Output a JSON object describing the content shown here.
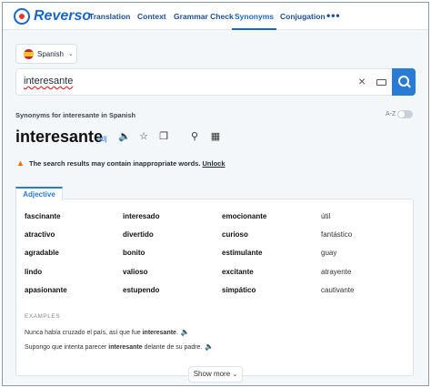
{
  "brand": {
    "name": "Reverso"
  },
  "nav": {
    "items": [
      {
        "label": "Translation"
      },
      {
        "label": "Context"
      },
      {
        "label": "Grammar Check"
      },
      {
        "label": "Synonyms"
      },
      {
        "label": "Conjugation"
      }
    ],
    "more_label": "•••"
  },
  "language": {
    "selected": "Spanish",
    "flag": "spain-flag-icon"
  },
  "search": {
    "value": "interesante",
    "clear_icon": "close-icon",
    "keyboard_icon": "keyboard-icon",
    "search_icon": "search-icon"
  },
  "results": {
    "heading": "Synonyms for interesante in Spanish",
    "sort_label": "A-Z",
    "word": "interesante",
    "part_of_speech": "adj",
    "tools": [
      "speaker-icon",
      "star-icon",
      "copy-icon",
      "zoom-icon",
      "document-icon"
    ],
    "warning_text": "The search results may contain inappropriate words.",
    "unlock_label": "Unlock"
  },
  "tab": {
    "label": "Adjective"
  },
  "synonyms": [
    [
      "fascinante",
      "interesado",
      "emocionante",
      "útil"
    ],
    [
      "atractivo",
      "divertido",
      "curioso",
      "fantástico"
    ],
    [
      "agradable",
      "bonito",
      "estimulante",
      "guay"
    ],
    [
      "lindo",
      "valioso",
      "excitante",
      "atrayente"
    ],
    [
      "apasionante",
      "estupendo",
      "simpático",
      "cautivante"
    ]
  ],
  "examples": {
    "label": "EXAMPLES",
    "items": [
      {
        "before": "Nunca había cruzado el país, así que fue ",
        "highlight": "interesante",
        "after": "."
      },
      {
        "before": "Supongo que intenta parecer ",
        "highlight": "interesante",
        "after": " delante de su padre."
      }
    ]
  },
  "show_more_label": "Show more",
  "colors": {
    "accent": "#2a7bd3",
    "warning": "#ef6c00"
  }
}
